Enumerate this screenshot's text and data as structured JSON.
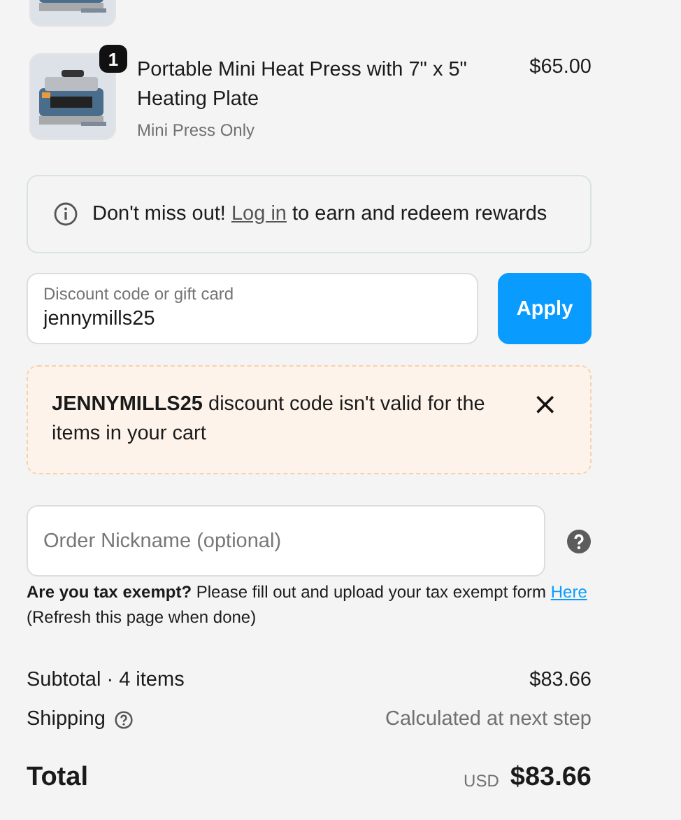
{
  "items": [
    {
      "kind": "clipped"
    },
    {
      "kind": "full",
      "quantity": "1",
      "title": "Portable Mini Heat Press with 7\" x 5\" Heating Plate",
      "variant": "Mini Press Only",
      "price": "$65.00"
    }
  ],
  "rewards": {
    "before": "Don't miss out!",
    "link": "Log in",
    "after": "to earn and redeem rewards"
  },
  "discount": {
    "label": "Discount code or gift card",
    "value": "jennymills25",
    "button": "Apply"
  },
  "error": {
    "message": "**JENNYMILLS25** discount code isn't valid for the items in your cart",
    "close": "×"
  },
  "nickname": {
    "placeholder": "Order Nickname (optional)"
  },
  "tax": {
    "text": "**Are you tax exempt?** Please fill out and upload your tax exempt form",
    "link": "Here",
    "note": "(Refresh this page when done)"
  },
  "summary": {
    "subtotal_label": "Subtotal · 4 items",
    "subtotal": "$83.66",
    "shipping_label": "Shipping",
    "shipping": "Calculated at next step",
    "total_label": "Total",
    "currency": "USD",
    "total": "$83.66"
  }
}
